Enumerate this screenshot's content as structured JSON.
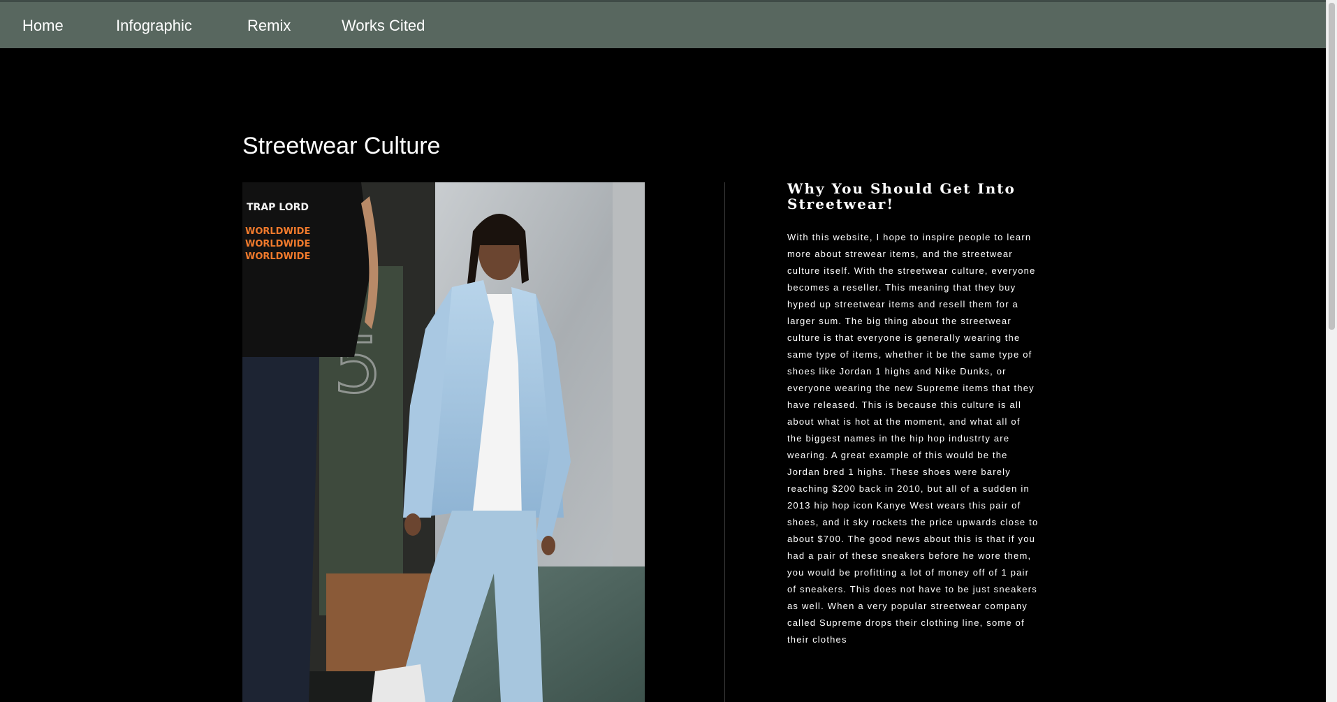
{
  "nav": {
    "items": [
      {
        "label": "Home"
      },
      {
        "label": "Infographic"
      },
      {
        "label": "Remix"
      },
      {
        "label": "Works Cited"
      }
    ]
  },
  "page": {
    "title": "Streetwear Culture"
  },
  "photo": {
    "shirt_text": "TRAP LORD",
    "shirt_repeat_text": "WORLDWIDE",
    "door_number": "5"
  },
  "article": {
    "heading": "Why You Should Get Into Streetwear!",
    "body": "With this website, I hope to inspire people to learn more about strewear items, and the streetwear culture itself. With the streetwear culture, everyone becomes a reseller. This meaning that they buy hyped up streetwear items and resell them for a larger sum. The big thing about the streetwear culture is that everyone is generally wearing the same type of items, whether it be the same type of shoes like Jordan 1 highs and Nike Dunks, or everyone wearing the new Supreme items that they have released. This is because this culture is all about what is hot at the moment, and what all of the biggest names in the hip hop industrty are wearing. A great example of this would be the Jordan bred 1 highs. These shoes were barely reaching $200 back in 2010, but all of a sudden in 2013 hip hop icon Kanye West wears this pair of shoes, and it sky rockets the price upwards close to about $700. The good news about this is that if you had a pair of these sneakers before he wore them, you would be profitting a lot of money off of 1 pair of sneakers. This does not have to be just sneakers as well. When a very popular streetwear company called Supreme drops their clothing line, some of their clothes"
  },
  "colors": {
    "navbar_bg": "#58675f",
    "page_bg": "#000000",
    "text": "#ffffff"
  }
}
